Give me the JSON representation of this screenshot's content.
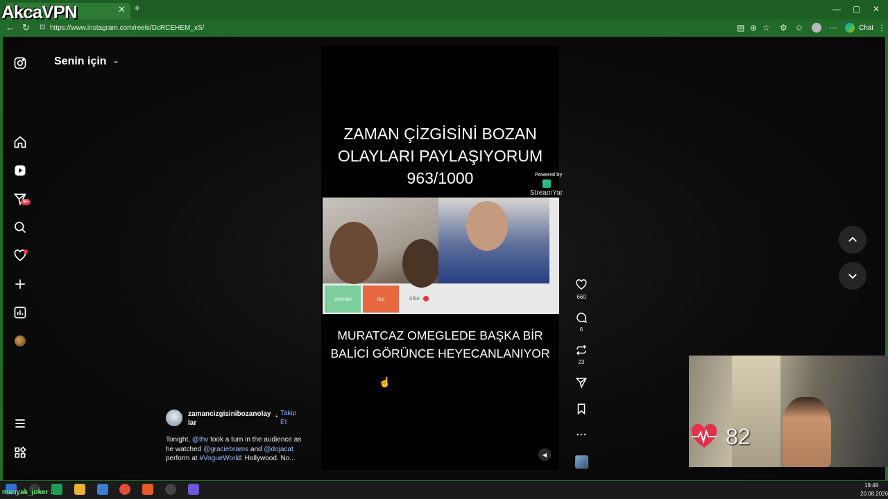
{
  "browser": {
    "logo_text": "AkcaVPN",
    "url": "https://www.instagram.com/reels/DcRCEHEM_xS/",
    "chat_label": "Chat",
    "controls": {
      "minimize": "—",
      "maximize": "▢",
      "close": "✕"
    }
  },
  "sidebar": {
    "feed_title": "Senin için",
    "notification_badge": "9+"
  },
  "reel": {
    "headline_lines": [
      "ZAMAN ÇİZGİSİNİ BOZAN",
      "OLAYLARI PAYLAŞIYORUM",
      "963/1000"
    ],
    "powered_by": "Powered by",
    "streamyard": "StreamYar",
    "video_buttons": {
      "next": "sonraki",
      "stop": "dur",
      "country": "ülke:"
    },
    "caption_lines": [
      "MURATCAZ OMEGLEDE BAŞKA BİR",
      "BALİCİ GÖRÜNCE HEYECANLANIYOR"
    ]
  },
  "actions": {
    "likes": "660",
    "comments": "6",
    "reposts": "23"
  },
  "post": {
    "author": "zamancizgisinibozanolaylar",
    "follow_dot": "•",
    "follow_label": "Takip Et",
    "caption_parts": [
      {
        "text": "Tonight, ",
        "mention": false
      },
      {
        "text": "@thv",
        "mention": true
      },
      {
        "text": " took a turn in the audience as he watched ",
        "mention": false
      },
      {
        "text": "@graciebrams",
        "mention": true
      },
      {
        "text": " and ",
        "mention": false
      },
      {
        "text": "@dojacat",
        "mention": true
      },
      {
        "text": " perform at ",
        "mention": false
      },
      {
        "text": "#VogueWorld",
        "mention": true
      },
      {
        "text": ": Hollywood. No...",
        "mention": false
      }
    ]
  },
  "overlay": {
    "heart_rate": "82"
  },
  "taskbar": {
    "user_tag": "manyak_joker :",
    "time": "19:49",
    "date": "20.08.2026"
  },
  "colors": {
    "browser_green": "#1d5e23",
    "accent_link": "#7aa7ff",
    "notification_red": "#ff3040",
    "heart_red": "#e2314b"
  }
}
